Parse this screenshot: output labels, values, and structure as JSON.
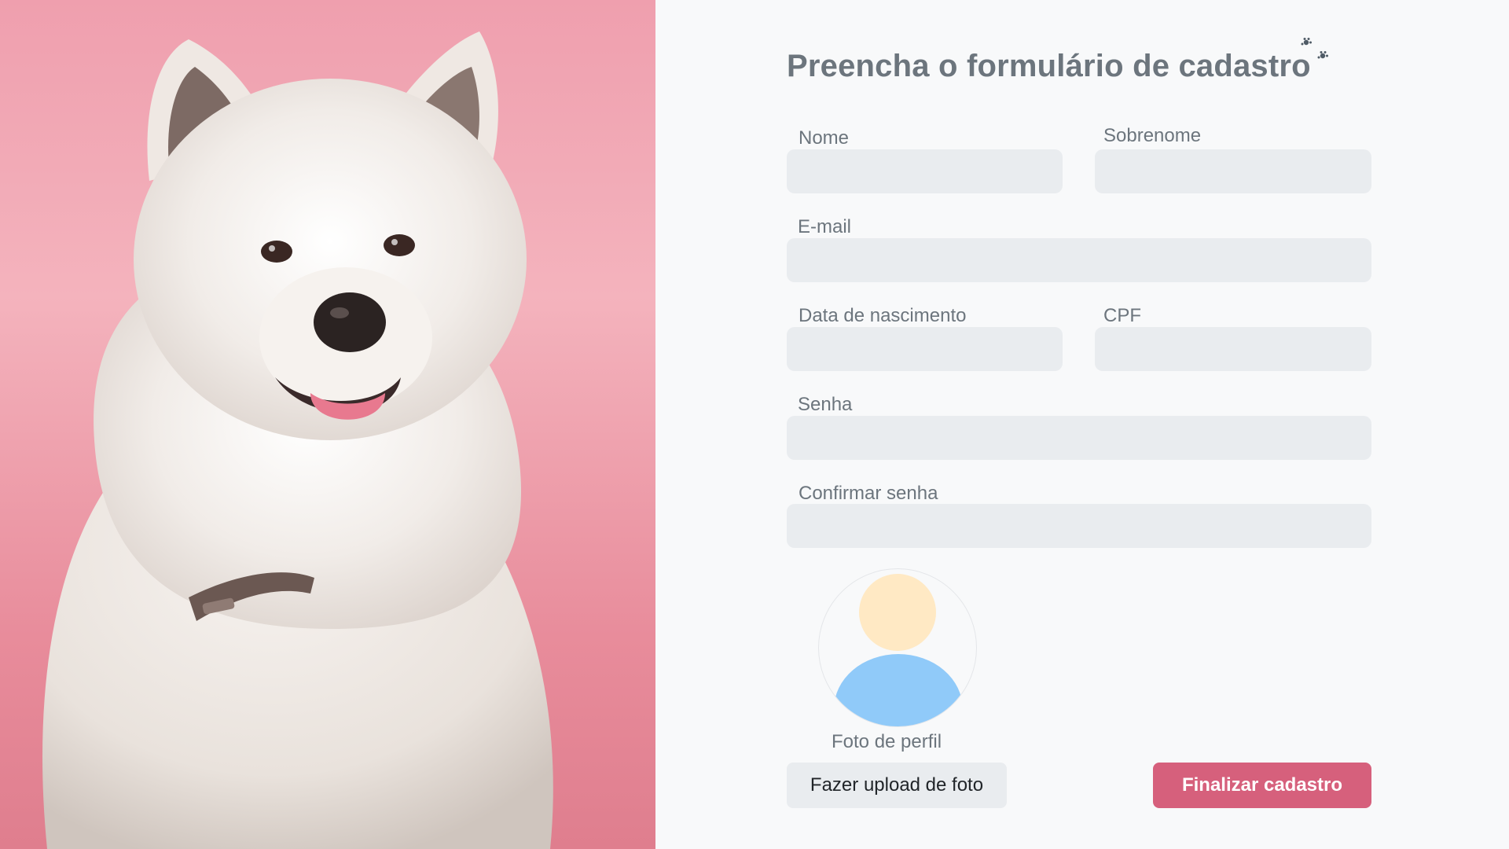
{
  "form": {
    "title": "Preencha o formulário de cadastro",
    "fields": {
      "nome": {
        "label": "Nome",
        "value": ""
      },
      "sobrenome": {
        "label": "Sobrenome",
        "value": ""
      },
      "email": {
        "label": "E-mail",
        "value": ""
      },
      "nascimento": {
        "label": "Data de nascimento",
        "value": ""
      },
      "cpf": {
        "label": "CPF",
        "value": ""
      },
      "senha": {
        "label": "Senha",
        "value": ""
      },
      "confirmar": {
        "label": "Confirmar senha",
        "value": ""
      }
    },
    "profile_photo_label": "Foto de perfil",
    "upload_button": "Fazer upload de foto",
    "submit_button": "Finalizar cadastro"
  },
  "colors": {
    "hero_background": "#ef9fae",
    "accent": "#d6607c",
    "text_muted": "#6c757d",
    "field_background": "#e9ecef",
    "avatar_head": "#ffe9c4",
    "avatar_body": "#90caf9"
  },
  "icons": {
    "title_decoration": "paw-prints-icon"
  }
}
